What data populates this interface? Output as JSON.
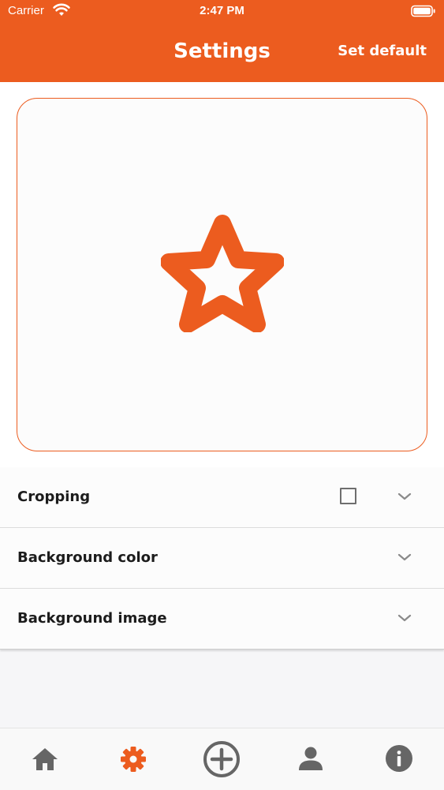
{
  "status_bar": {
    "carrier": "Carrier",
    "time": "2:47 PM"
  },
  "nav": {
    "title": "Settings",
    "action_label": "Set default"
  },
  "preview": {
    "icon": "star-icon",
    "accent_color": "#ec5c1f"
  },
  "settings": {
    "rows": [
      {
        "label": "Cropping",
        "has_checkbox": true,
        "checked": false
      },
      {
        "label": "Background color",
        "has_checkbox": false
      },
      {
        "label": "Background image",
        "has_checkbox": false
      }
    ]
  },
  "tab_bar": {
    "tabs": [
      {
        "icon": "home-icon",
        "active": false
      },
      {
        "icon": "gear-icon",
        "active": true
      },
      {
        "icon": "add-circle-icon",
        "active": false
      },
      {
        "icon": "person-icon",
        "active": false
      },
      {
        "icon": "info-icon",
        "active": false
      }
    ],
    "active_color": "#ec5c1f",
    "inactive_color": "#666666"
  }
}
